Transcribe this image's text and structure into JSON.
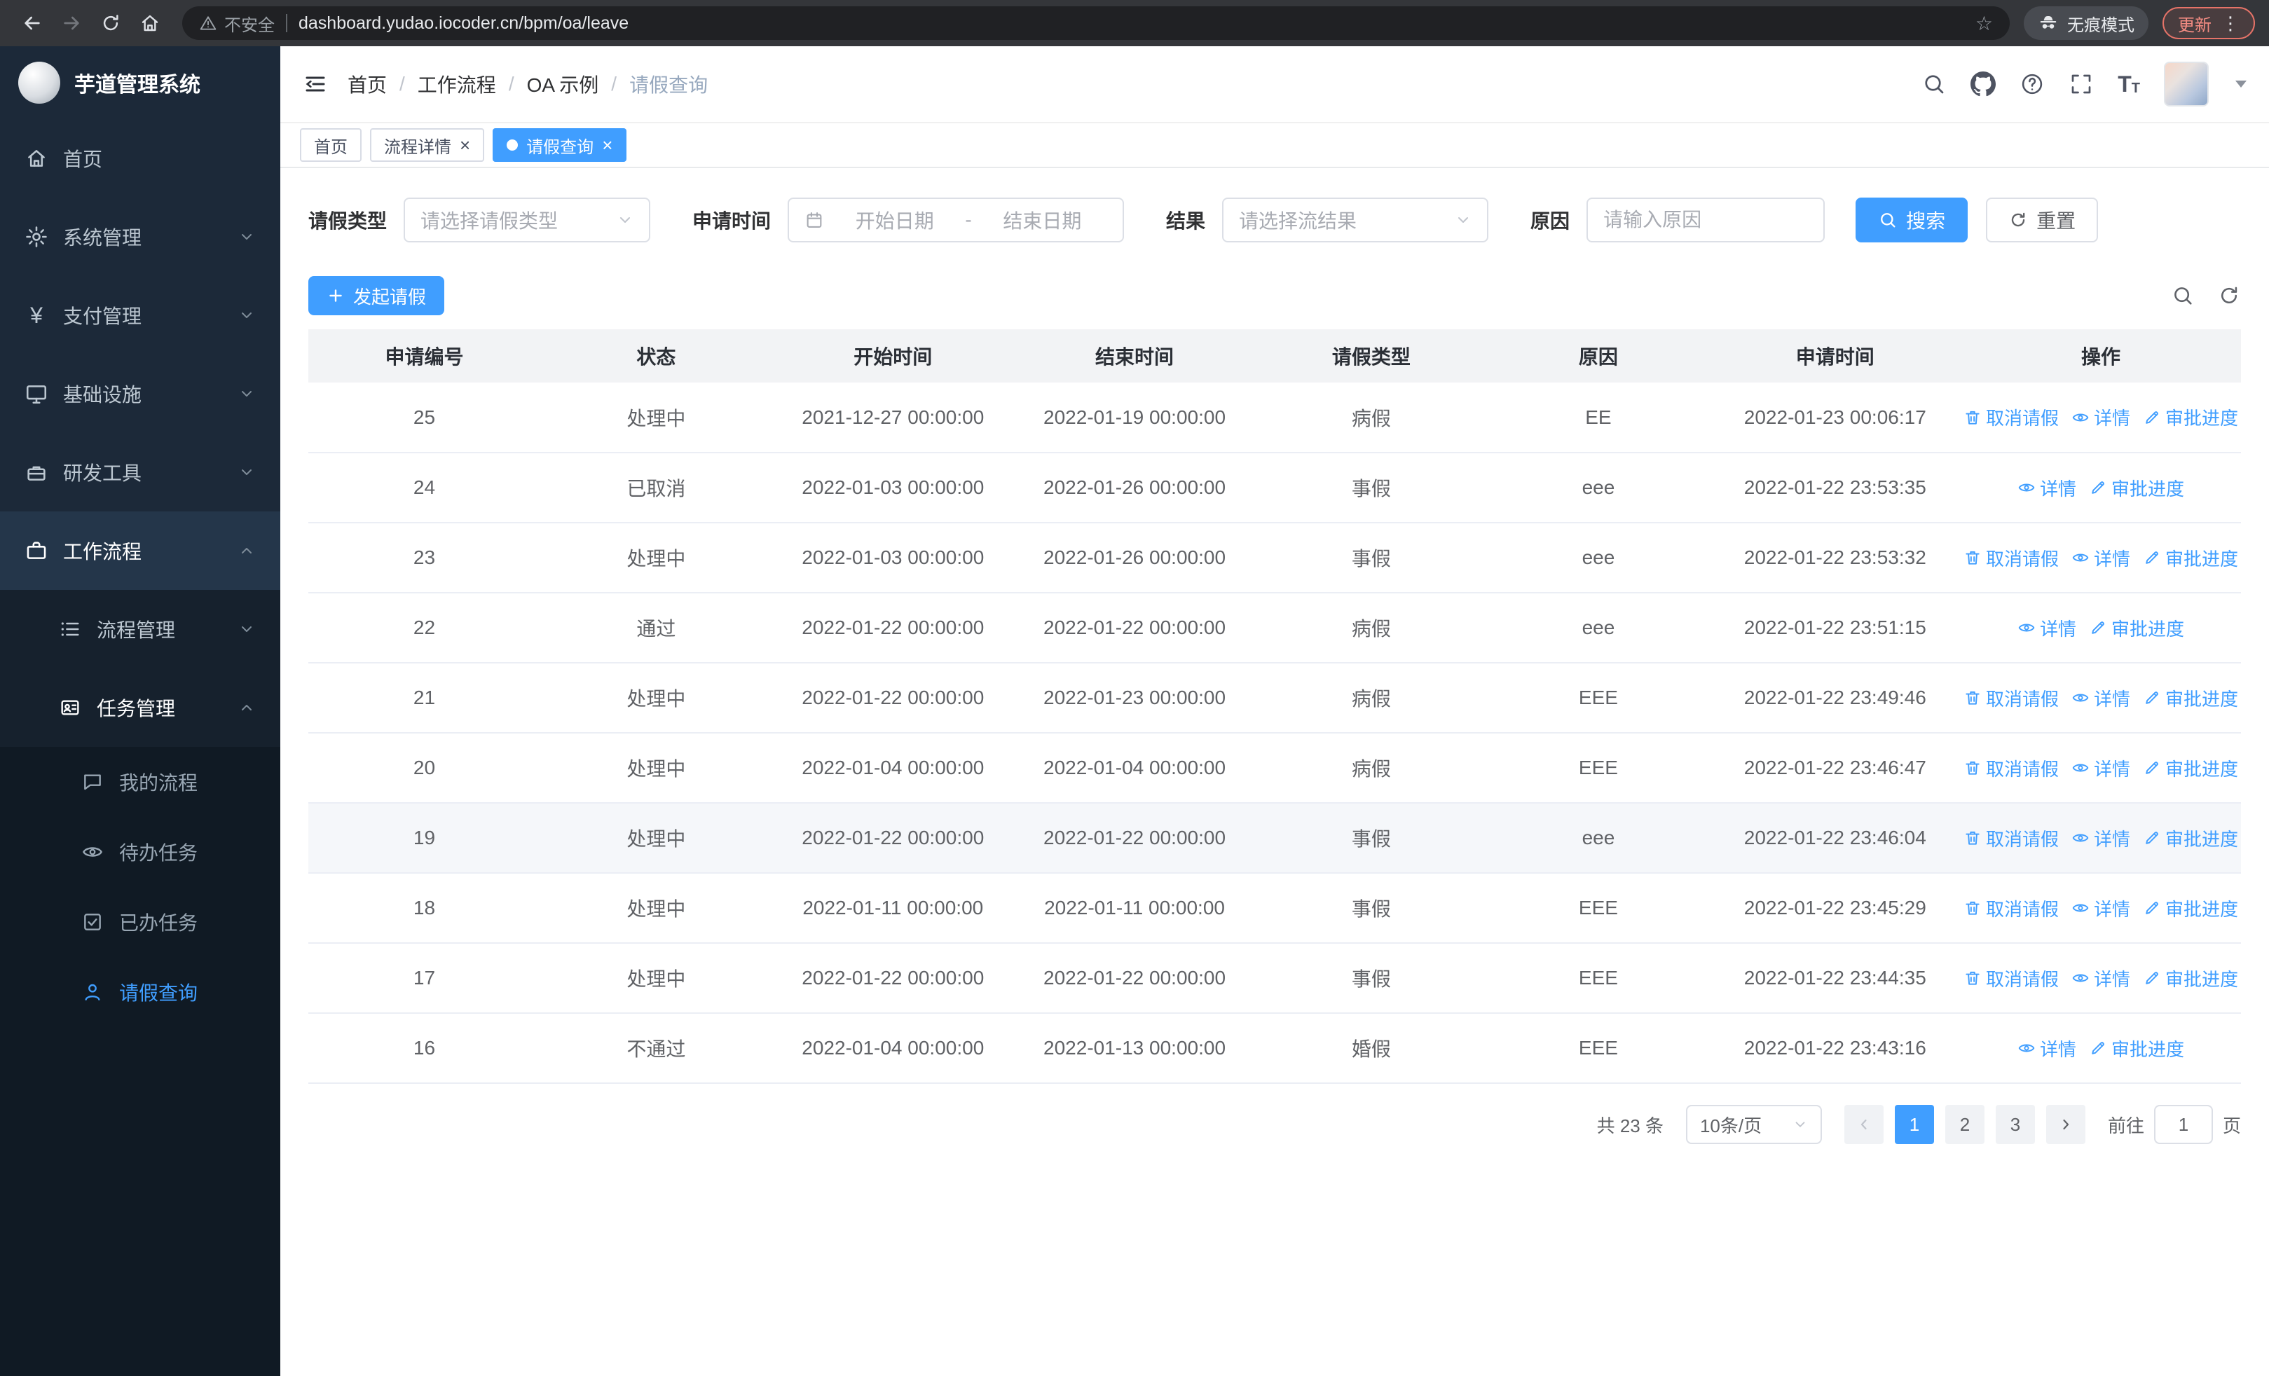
{
  "browser": {
    "security_label": "不安全",
    "url": "dashboard.yudao.iocoder.cn/bpm/oa/leave",
    "incognito_label": "无痕模式",
    "update_label": "更新"
  },
  "icons": {
    "close": "×",
    "star": "☆",
    "menu_dots": "⋮",
    "yen": "¥",
    "font_size": "T"
  },
  "colors": {
    "primary": "#409eff",
    "sidebar_bg": "#1c2939"
  },
  "sidebar": {
    "logo_title": "芋道管理系统",
    "items": [
      {
        "label": "首页"
      },
      {
        "label": "系统管理"
      },
      {
        "label": "支付管理"
      },
      {
        "label": "基础设施"
      },
      {
        "label": "研发工具"
      },
      {
        "label": "工作流程"
      },
      {
        "label": "流程管理"
      },
      {
        "label": "任务管理"
      },
      {
        "label": "我的流程"
      },
      {
        "label": "待办任务"
      },
      {
        "label": "已办任务"
      },
      {
        "label": "请假查询"
      }
    ]
  },
  "header": {
    "breadcrumb": [
      {
        "label": "首页"
      },
      {
        "label": "工作流程"
      },
      {
        "label": "OA 示例"
      },
      {
        "label": "请假查询"
      }
    ]
  },
  "tabs": [
    {
      "label": "首页"
    },
    {
      "label": "流程详情"
    },
    {
      "label": "请假查询"
    }
  ],
  "filters": {
    "leave_type_label": "请假类型",
    "leave_type_placeholder": "请选择请假类型",
    "apply_time_label": "申请时间",
    "start_placeholder": "开始日期",
    "range_separator": "-",
    "end_placeholder": "结束日期",
    "result_label": "结果",
    "result_placeholder": "请选择流结果",
    "reason_label": "原因",
    "reason_placeholder": "请输入原因",
    "search_label": "搜索",
    "reset_label": "重置"
  },
  "toolbar": {
    "create_label": "发起请假"
  },
  "table": {
    "columns": [
      "申请编号",
      "状态",
      "开始时间",
      "结束时间",
      "请假类型",
      "原因",
      "申请时间",
      "操作"
    ],
    "op_labels": {
      "cancel": "取消请假",
      "detail": "详情",
      "progress": "审批进度"
    },
    "rows": [
      {
        "id": "25",
        "status": "处理中",
        "start": "2021-12-27 00:00:00",
        "end": "2022-01-19 00:00:00",
        "type": "病假",
        "reason": "EE",
        "applied": "2022-01-23 00:06:17",
        "can_cancel": true
      },
      {
        "id": "24",
        "status": "已取消",
        "start": "2022-01-03 00:00:00",
        "end": "2022-01-26 00:00:00",
        "type": "事假",
        "reason": "eee",
        "applied": "2022-01-22 23:53:35",
        "can_cancel": false
      },
      {
        "id": "23",
        "status": "处理中",
        "start": "2022-01-03 00:00:00",
        "end": "2022-01-26 00:00:00",
        "type": "事假",
        "reason": "eee",
        "applied": "2022-01-22 23:53:32",
        "can_cancel": true
      },
      {
        "id": "22",
        "status": "通过",
        "start": "2022-01-22 00:00:00",
        "end": "2022-01-22 00:00:00",
        "type": "病假",
        "reason": "eee",
        "applied": "2022-01-22 23:51:15",
        "can_cancel": false
      },
      {
        "id": "21",
        "status": "处理中",
        "start": "2022-01-22 00:00:00",
        "end": "2022-01-23 00:00:00",
        "type": "病假",
        "reason": "EEE",
        "applied": "2022-01-22 23:49:46",
        "can_cancel": true
      },
      {
        "id": "20",
        "status": "处理中",
        "start": "2022-01-04 00:00:00",
        "end": "2022-01-04 00:00:00",
        "type": "病假",
        "reason": "EEE",
        "applied": "2022-01-22 23:46:47",
        "can_cancel": true
      },
      {
        "id": "19",
        "status": "处理中",
        "start": "2022-01-22 00:00:00",
        "end": "2022-01-22 00:00:00",
        "type": "事假",
        "reason": "eee",
        "applied": "2022-01-22 23:46:04",
        "can_cancel": true,
        "row_class": "hl"
      },
      {
        "id": "18",
        "status": "处理中",
        "start": "2022-01-11 00:00:00",
        "end": "2022-01-11 00:00:00",
        "type": "事假",
        "reason": "EEE",
        "applied": "2022-01-22 23:45:29",
        "can_cancel": true
      },
      {
        "id": "17",
        "status": "处理中",
        "start": "2022-01-22 00:00:00",
        "end": "2022-01-22 00:00:00",
        "type": "事假",
        "reason": "EEE",
        "applied": "2022-01-22 23:44:35",
        "can_cancel": true
      },
      {
        "id": "16",
        "status": "不通过",
        "start": "2022-01-04 00:00:00",
        "end": "2022-01-13 00:00:00",
        "type": "婚假",
        "reason": "EEE",
        "applied": "2022-01-22 23:43:16",
        "can_cancel": false
      }
    ]
  },
  "pagination": {
    "total_label": "共 23 条",
    "page_size_value": "10条/页",
    "pages": [
      "1",
      "2",
      "3"
    ],
    "active_page": "1",
    "goto_label": "前往",
    "goto_value": "1",
    "page_unit_label": "页"
  }
}
